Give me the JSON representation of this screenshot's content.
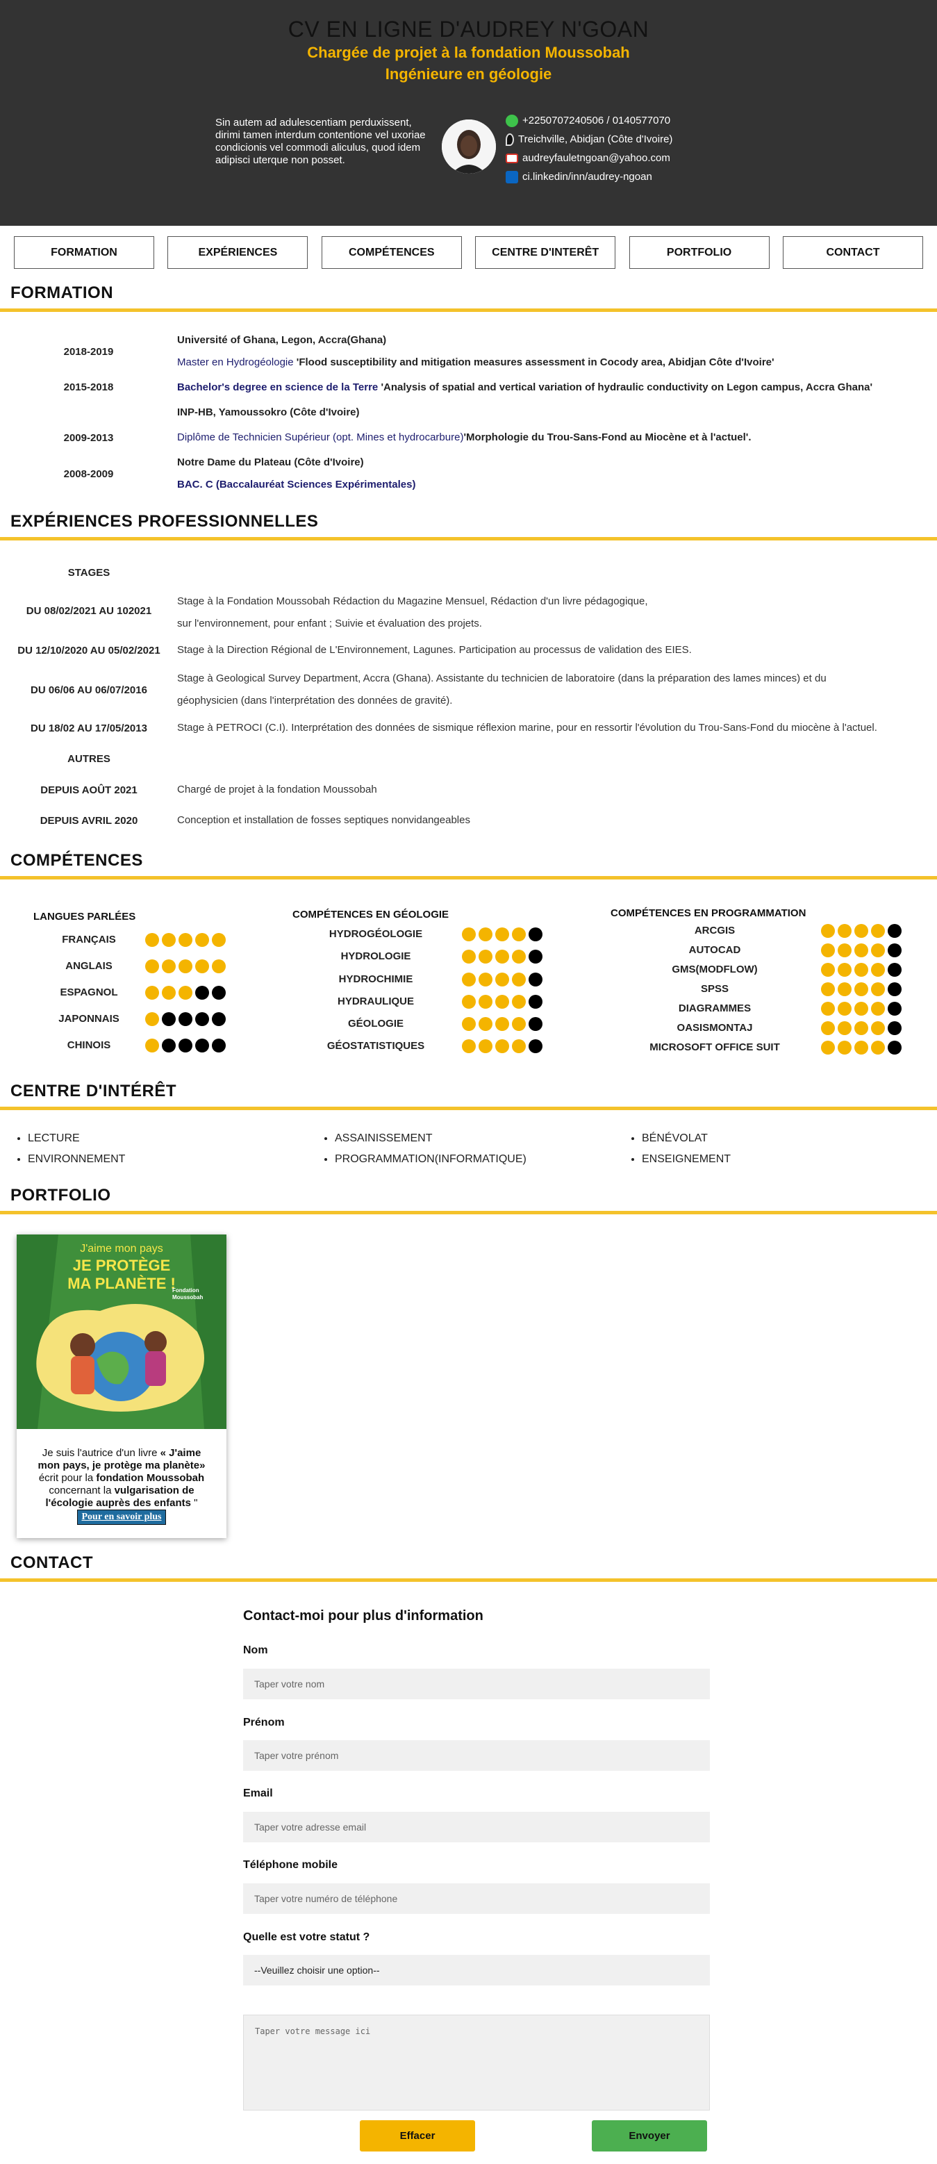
{
  "header": {
    "title": "CV EN LIGNE D'AUDREY N'GOAN",
    "subtitle1": "Chargée de projet à la fondation Moussobah",
    "subtitle2": "Ingénieure en géologie",
    "intro": "Sin autem ad adulescentiam perduxissent, dirimi tamen interdum contentione vel uxoriae condicionis vel commodi aliculus, quod idem adipisci uterque non posset.",
    "phone": "+2250707240506 / 0140577070",
    "address": "Treichville, Abidjan (Côte d'Ivoire)",
    "email": "audreyfauletngoan@yahoo.com",
    "linkedin": "ci.linkedin/inn/audrey-ngoan"
  },
  "nav": [
    "FORMATION",
    "EXPÉRIENCES",
    "COMPÉTENCES",
    "CENTRE D'INTERÊT",
    "PORTFOLIO",
    "CONTACT"
  ],
  "formation": {
    "title": "FORMATION",
    "items": [
      {
        "date": "2018-2019",
        "school": "Université of Ghana, Legon, Accra(Ghana)",
        "degree": "Master en Hydrogéologie",
        "thesis": "'Flood susceptibility and mitigation measures assessment in Cocody area, Abidjan Côte d'Ivoire'"
      },
      {
        "date": "2015-2018",
        "school": "",
        "degree": "Bachelor's degree en science de la Terre",
        "thesis": "'Analysis of spatial and vertical variation of hydraulic conductivity on Legon campus, Accra Ghana'"
      },
      {
        "date": "2009-2013",
        "school": "INP-HB, Yamoussokro (Côte d'Ivoire)",
        "degree": "Diplôme de Technicien Supérieur (opt. Mines et hydrocarbure)",
        "thesis": "'Morphologie du Trou-Sans-Fond au Miocène et à l'actuel'."
      },
      {
        "date": "2008-2009",
        "school": "Notre Dame du Plateau (Côte d'Ivoire)",
        "degree": "BAC. C (Baccalauréat Sciences Expérimentales)",
        "thesis": ""
      }
    ]
  },
  "experiences": {
    "title": "EXPÉRIENCES PROFESSIONNELLES",
    "stages_label": "STAGES",
    "stages": [
      {
        "date": "DU 08/02/2021 AU 102021",
        "line1": "Stage à la Fondation Moussobah Rédaction du Magazine Mensuel, Rédaction d'un livre pédagogique,",
        "line2": "sur l'environnement, pour enfant ; Suivie et évaluation des projets."
      },
      {
        "date": "DU 12/10/2020 AU 05/02/2021",
        "line1": "Stage à la Direction Régional de L'Environnement, Lagunes. Participation au processus de validation des EIES.",
        "line2": ""
      },
      {
        "date": "DU 06/06 AU 06/07/2016",
        "line1": "Stage à Geological Survey Department, Accra (Ghana). Assistante du technicien de laboratoire (dans la préparation des lames minces) et du",
        "line2": "géophysicien (dans l'interprétation des données de gravité)."
      },
      {
        "date": "DU 18/02 AU 17/05/2013",
        "line1": "Stage à PETROCI (C.I). Interprétation des données de sismique réflexion marine, pour en ressortir l'évolution du Trou-Sans-Fond du miocène à l'actuel.",
        "line2": ""
      }
    ],
    "autres_label": "AUTRES",
    "autres": [
      {
        "date": "DEPUIS AOÛT 2021",
        "text": "Chargé de projet à la fondation Moussobah"
      },
      {
        "date": "DEPUIS AVRIL 2020",
        "text": "Conception et installation de fosses septiques nonvidangeables"
      }
    ]
  },
  "competences": {
    "title": "COMPÉTENCES",
    "langues": {
      "head": "LANGUES PARLÉES",
      "items": [
        {
          "label": "FRANÇAIS",
          "level": 5
        },
        {
          "label": "ANGLAIS",
          "level": 5
        },
        {
          "label": "ESPAGNOL",
          "level": 3
        },
        {
          "label": "JAPONNAIS",
          "level": 1
        },
        {
          "label": "CHINOIS",
          "level": 1
        }
      ]
    },
    "geologie": {
      "head": "COMPÉTENCES EN GÉOLOGIE",
      "items": [
        {
          "label": "HYDROGÉOLOGIE",
          "level": 4
        },
        {
          "label": "HYDROLOGIE",
          "level": 4
        },
        {
          "label": "HYDROCHIMIE",
          "level": 4
        },
        {
          "label": "HYDRAULIQUE",
          "level": 4
        },
        {
          "label": "GÉOLOGIE",
          "level": 4
        },
        {
          "label": "GÉOSTATISTIQUES",
          "level": 4
        }
      ]
    },
    "programmation": {
      "head": "COMPÉTENCES EN PROGRAMMATION",
      "items": [
        {
          "label": "ARCGIS",
          "level": 4
        },
        {
          "label": "AUTOCAD",
          "level": 4
        },
        {
          "label": "GMS(MODFLOW)",
          "level": 4
        },
        {
          "label": "SPSS",
          "level": 4
        },
        {
          "label": "DIAGRAMMES",
          "level": 4
        },
        {
          "label": "OASISMONTAJ",
          "level": 4
        },
        {
          "label": "MICROSOFT OFFICE SUIT",
          "level": 4
        }
      ]
    }
  },
  "interets": {
    "title": "CENTRE D'INTÉRÊT",
    "col1": [
      "LECTURE",
      "ENVIRONNEMENT"
    ],
    "col2": [
      "ASSAINISSEMENT",
      "PROGRAMMATION(INFORMATIQUE)"
    ],
    "col3": [
      "BÉNÉVOLAT",
      "ENSEIGNEMENT"
    ]
  },
  "portfolio": {
    "title": "PORTFOLIO",
    "book_line1": "J'aime mon pays",
    "book_line2": "JE PROTÈGE",
    "book_line3": "MA PLANÈTE !",
    "book_brand": "Fondation Moussobah",
    "text_a": "Je suis l'autrice d'un livre ",
    "text_b": "« J'aime mon pays, je protège ma planète»",
    "text_c": " écrit pour la ",
    "text_d": "fondation Moussobah",
    "text_e": " concernant la ",
    "text_f": "vulgarisation de l'écologie auprès des enfants",
    "text_g": " \"",
    "more": "Pour en savoir plus"
  },
  "contact": {
    "title": "CONTACT",
    "form_title": "Contact-moi pour plus d'information",
    "nom_label": "Nom",
    "nom_ph": "Taper votre nom",
    "prenom_label": "Prénom",
    "prenom_ph": "Taper votre prénom",
    "email_label": "Email",
    "email_ph": "Taper votre adresse email",
    "tel_label": "Téléphone mobile",
    "tel_ph": "Taper votre numéro de téléphone",
    "statut_label": "Quelle est votre statut ?",
    "statut_value": "--Veuillez choisir une option--",
    "message_ph": "Taper votre message ici",
    "reset": "Effacer",
    "send": "Envoyer"
  },
  "colors": {
    "accent": "#f4b400",
    "header_bg": "#333333",
    "send": "#4caf50",
    "reset": "#f4b400",
    "link_bg": "#1f6c9f"
  }
}
